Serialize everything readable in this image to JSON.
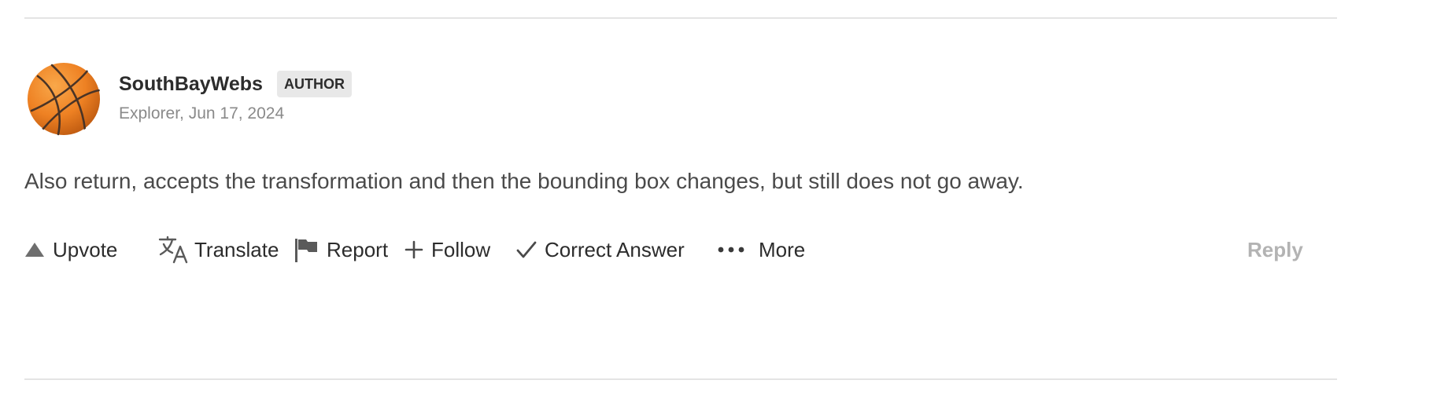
{
  "post": {
    "author": {
      "name": "SouthBayWebs",
      "badge": "AUTHOR",
      "meta": "Explorer, Jun 17, 2024",
      "avatar_icon": "basketball-icon"
    },
    "message": "Also return, accepts the transformation and then the bounding box changes, but still does not go away."
  },
  "actions": {
    "upvote": {
      "label": "Upvote",
      "icon": "triangle-up-icon"
    },
    "translate": {
      "label": "Translate",
      "icon": "translate-icon"
    },
    "report": {
      "label": "Report",
      "icon": "flag-icon"
    },
    "follow": {
      "label": "Follow",
      "icon": "plus-icon"
    },
    "correct_answer": {
      "label": "Correct Answer",
      "icon": "checkmark-icon"
    },
    "more": {
      "label": "More",
      "icon": "ellipsis-icon"
    },
    "reply": {
      "label": "Reply"
    }
  },
  "colors": {
    "text": "#2c2c2c",
    "muted": "#8a8a8a",
    "reply_disabled": "#b3b3b3",
    "badge_bg": "#e8e8e8",
    "divider": "#e4e4e4",
    "avatar_orange": "#f08a24"
  }
}
